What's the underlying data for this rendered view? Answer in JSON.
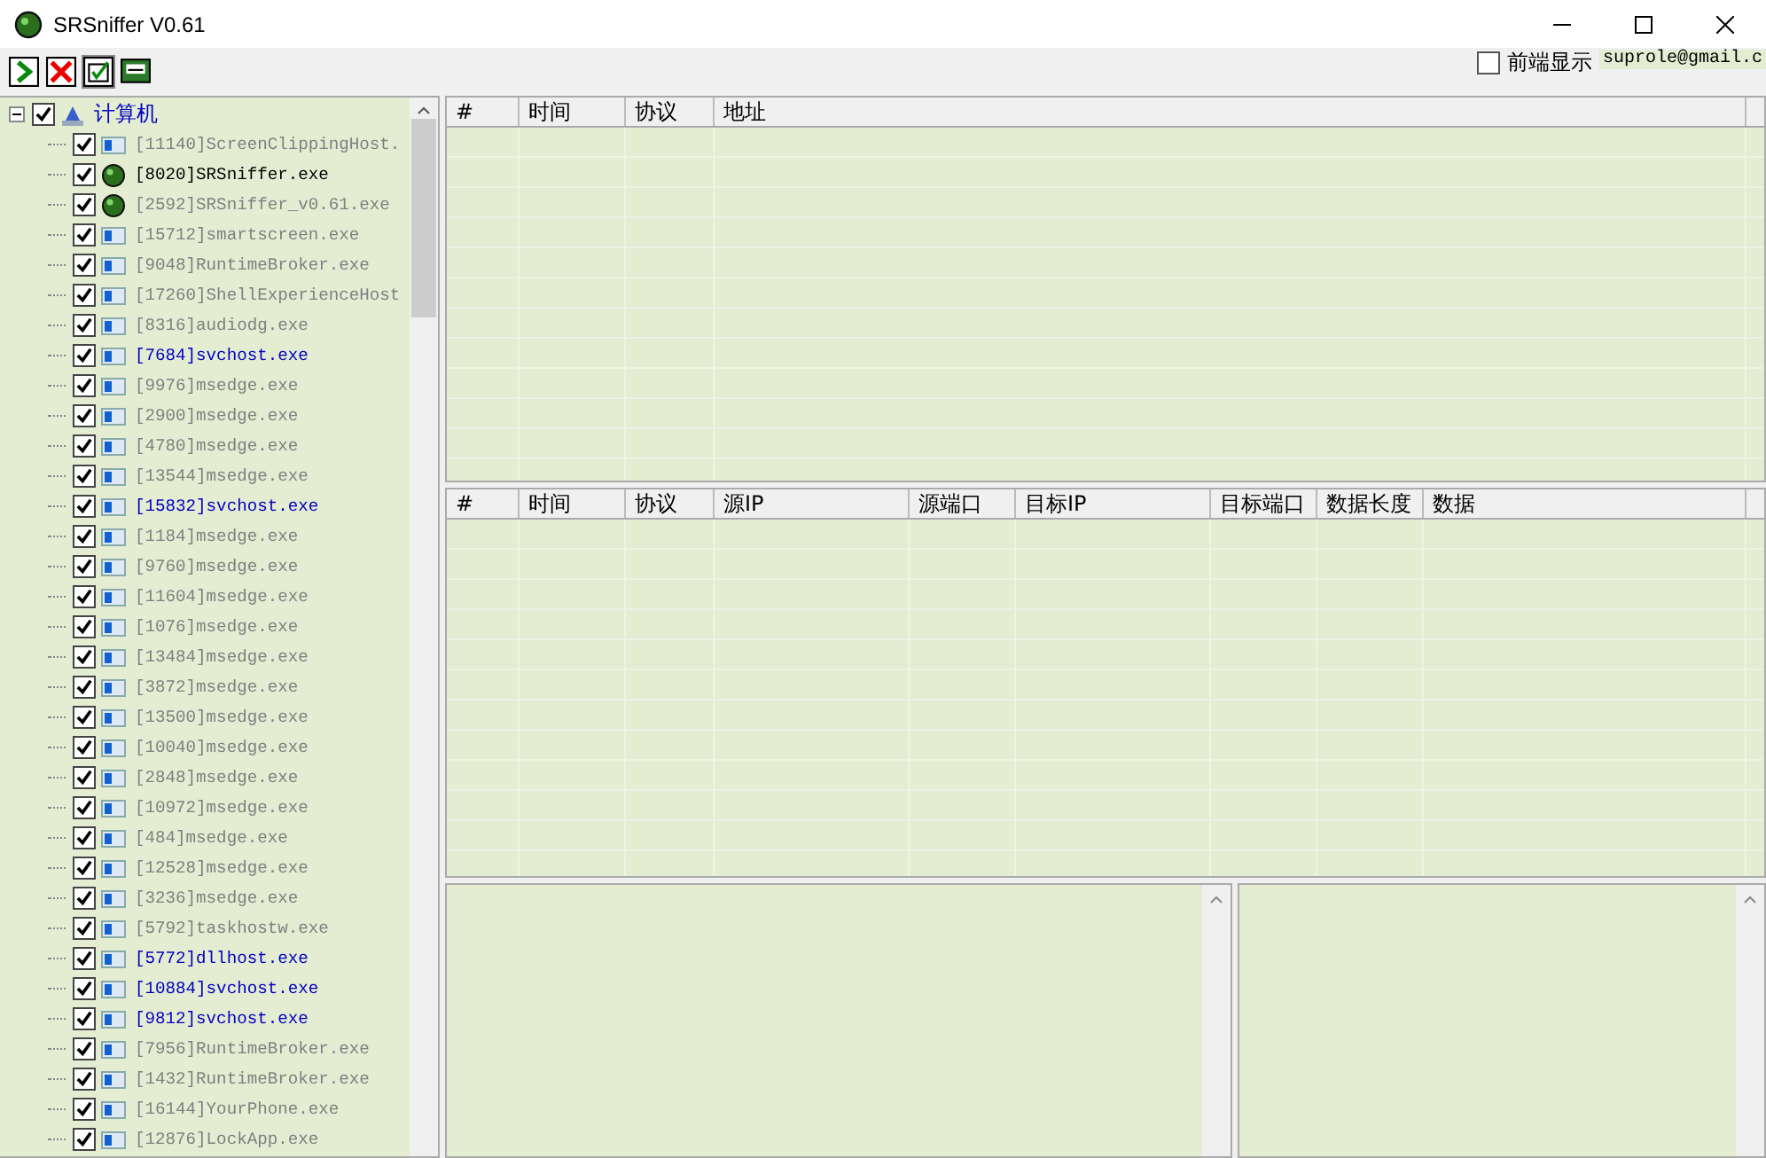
{
  "window": {
    "title": "SRSniffer V0.61"
  },
  "toolbar": {
    "front_display": {
      "label": "前端显示",
      "checked": false
    },
    "email": "suprole@gmail.c"
  },
  "tree": {
    "root": {
      "label": "计算机",
      "checked": true,
      "expanded": true,
      "children": [
        {
          "label": "[11140]ScreenClippingHost.",
          "kind": "window",
          "checked": true,
          "color": "#808080"
        },
        {
          "label": "[8020]SRSniffer.exe",
          "kind": "sniffer",
          "checked": true,
          "color": "#000000"
        },
        {
          "label": "[2592]SRSniffer_v0.61.exe",
          "kind": "sniffer",
          "checked": true,
          "color": "#808080"
        },
        {
          "label": "[15712]smartscreen.exe",
          "kind": "window",
          "checked": true,
          "color": "#808080"
        },
        {
          "label": "[9048]RuntimeBroker.exe",
          "kind": "window",
          "checked": true,
          "color": "#808080"
        },
        {
          "label": "[17260]ShellExperienceHost",
          "kind": "window",
          "checked": true,
          "color": "#808080"
        },
        {
          "label": "[8316]audiodg.exe",
          "kind": "window",
          "checked": true,
          "color": "#808080"
        },
        {
          "label": "[7684]svchost.exe",
          "kind": "window",
          "checked": true,
          "color": "#0000c0"
        },
        {
          "label": "[9976]msedge.exe",
          "kind": "window",
          "checked": true,
          "color": "#808080"
        },
        {
          "label": "[2900]msedge.exe",
          "kind": "window",
          "checked": true,
          "color": "#808080"
        },
        {
          "label": "[4780]msedge.exe",
          "kind": "window",
          "checked": true,
          "color": "#808080"
        },
        {
          "label": "[13544]msedge.exe",
          "kind": "window",
          "checked": true,
          "color": "#808080"
        },
        {
          "label": "[15832]svchost.exe",
          "kind": "window",
          "checked": true,
          "color": "#0000c0"
        },
        {
          "label": "[1184]msedge.exe",
          "kind": "window",
          "checked": true,
          "color": "#808080"
        },
        {
          "label": "[9760]msedge.exe",
          "kind": "window",
          "checked": true,
          "color": "#808080"
        },
        {
          "label": "[11604]msedge.exe",
          "kind": "window",
          "checked": true,
          "color": "#808080"
        },
        {
          "label": "[1076]msedge.exe",
          "kind": "window",
          "checked": true,
          "color": "#808080"
        },
        {
          "label": "[13484]msedge.exe",
          "kind": "window",
          "checked": true,
          "color": "#808080"
        },
        {
          "label": "[3872]msedge.exe",
          "kind": "window",
          "checked": true,
          "color": "#808080"
        },
        {
          "label": "[13500]msedge.exe",
          "kind": "window",
          "checked": true,
          "color": "#808080"
        },
        {
          "label": "[10040]msedge.exe",
          "kind": "window",
          "checked": true,
          "color": "#808080"
        },
        {
          "label": "[2848]msedge.exe",
          "kind": "window",
          "checked": true,
          "color": "#808080"
        },
        {
          "label": "[10972]msedge.exe",
          "kind": "window",
          "checked": true,
          "color": "#808080"
        },
        {
          "label": "[484]msedge.exe",
          "kind": "window",
          "checked": true,
          "color": "#808080"
        },
        {
          "label": "[12528]msedge.exe",
          "kind": "window",
          "checked": true,
          "color": "#808080"
        },
        {
          "label": "[3236]msedge.exe",
          "kind": "window",
          "checked": true,
          "color": "#808080"
        },
        {
          "label": "[5792]taskhostw.exe",
          "kind": "window",
          "checked": true,
          "color": "#808080"
        },
        {
          "label": "[5772]dllhost.exe",
          "kind": "window",
          "checked": true,
          "color": "#0000c0"
        },
        {
          "label": "[10884]svchost.exe",
          "kind": "window",
          "checked": true,
          "color": "#0000c0"
        },
        {
          "label": "[9812]svchost.exe",
          "kind": "window",
          "checked": true,
          "color": "#0000c0"
        },
        {
          "label": "[7956]RuntimeBroker.exe",
          "kind": "window",
          "checked": true,
          "color": "#808080"
        },
        {
          "label": "[1432]RuntimeBroker.exe",
          "kind": "window",
          "checked": true,
          "color": "#808080"
        },
        {
          "label": "[16144]YourPhone.exe",
          "kind": "window",
          "checked": true,
          "color": "#808080"
        },
        {
          "label": "[12876]LockApp.exe",
          "kind": "window",
          "checked": true,
          "color": "#808080"
        }
      ]
    }
  },
  "url_table": {
    "columns": [
      "#",
      "时间",
      "协议",
      "地址"
    ]
  },
  "packet_table": {
    "columns": [
      "#",
      "时间",
      "协议",
      "源IP",
      "源端口",
      "目标IP",
      "目标端口",
      "数据长度",
      "数据"
    ]
  }
}
